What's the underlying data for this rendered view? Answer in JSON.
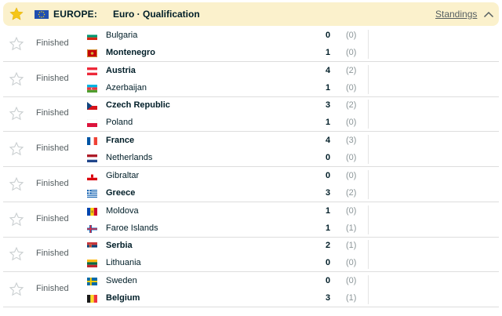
{
  "header": {
    "country": "EUROPE:",
    "league": "Euro · Qualification",
    "standings_label": "Standings",
    "star_color": "#f5c518",
    "flag": "eu-flag-icon"
  },
  "matches": [
    {
      "status": "Finished",
      "home": {
        "name": "Bulgaria",
        "flag": "bulgaria",
        "score": "0",
        "ht": "(0)",
        "winner": false
      },
      "away": {
        "name": "Montenegro",
        "flag": "montenegro",
        "score": "1",
        "ht": "(0)",
        "winner": true
      }
    },
    {
      "status": "Finished",
      "home": {
        "name": "Austria",
        "flag": "austria",
        "score": "4",
        "ht": "(2)",
        "winner": true
      },
      "away": {
        "name": "Azerbaijan",
        "flag": "azerbaijan",
        "score": "1",
        "ht": "(0)",
        "winner": false
      }
    },
    {
      "status": "Finished",
      "home": {
        "name": "Czech Republic",
        "flag": "czech",
        "score": "3",
        "ht": "(2)",
        "winner": true
      },
      "away": {
        "name": "Poland",
        "flag": "poland",
        "score": "1",
        "ht": "(0)",
        "winner": false
      }
    },
    {
      "status": "Finished",
      "home": {
        "name": "France",
        "flag": "france",
        "score": "4",
        "ht": "(3)",
        "winner": true
      },
      "away": {
        "name": "Netherlands",
        "flag": "netherlands",
        "score": "0",
        "ht": "(0)",
        "winner": false
      }
    },
    {
      "status": "Finished",
      "home": {
        "name": "Gibraltar",
        "flag": "gibraltar",
        "score": "0",
        "ht": "(0)",
        "winner": false
      },
      "away": {
        "name": "Greece",
        "flag": "greece",
        "score": "3",
        "ht": "(2)",
        "winner": true
      }
    },
    {
      "status": "Finished",
      "home": {
        "name": "Moldova",
        "flag": "moldova",
        "score": "1",
        "ht": "(0)",
        "winner": false
      },
      "away": {
        "name": "Faroe Islands",
        "flag": "faroe",
        "score": "1",
        "ht": "(1)",
        "winner": false
      }
    },
    {
      "status": "Finished",
      "home": {
        "name": "Serbia",
        "flag": "serbia",
        "score": "2",
        "ht": "(1)",
        "winner": true
      },
      "away": {
        "name": "Lithuania",
        "flag": "lithuania",
        "score": "0",
        "ht": "(0)",
        "winner": false
      }
    },
    {
      "status": "Finished",
      "home": {
        "name": "Sweden",
        "flag": "sweden",
        "score": "0",
        "ht": "(0)",
        "winner": false
      },
      "away": {
        "name": "Belgium",
        "flag": "belgium",
        "score": "3",
        "ht": "(1)",
        "winner": true
      }
    }
  ]
}
